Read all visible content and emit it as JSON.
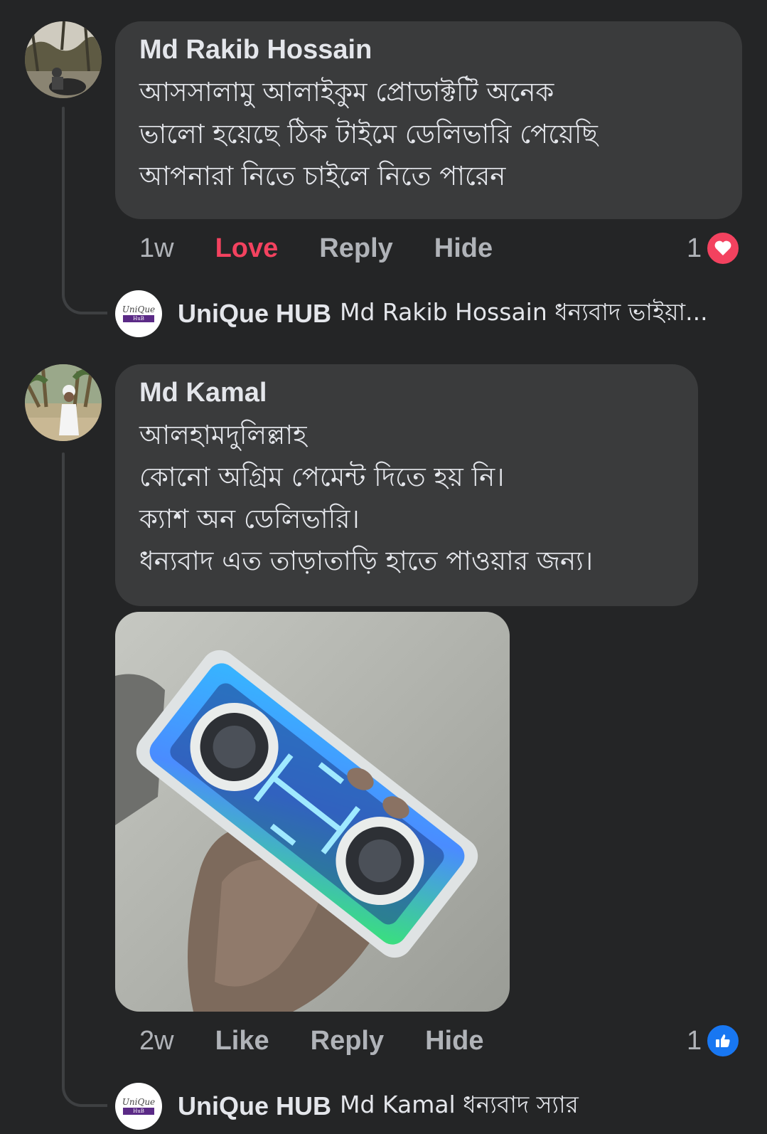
{
  "comments": [
    {
      "author": "Md Rakib Hossain",
      "lines": [
        "আসসালামু আলাইকুম প্রোডাক্টটি অনেক",
        "ভালো হয়েছে ঠিক টাইমে ডেলিভারি পেয়েছি",
        "আপনারা নিতে চাইলে নিতে পারেন"
      ],
      "time": "1w",
      "react_label": "Love",
      "reply_label": "Reply",
      "hide_label": "Hide",
      "reaction_count": "1",
      "reaction_icon": "heart-icon",
      "reaction_color": "#f3425f",
      "reply": {
        "page_name": "UniQue HUB",
        "text": "Md Rakib Hossain ধন্যবাদ ভাইয়া...",
        "logo_top": "UniQue",
        "logo_bottom": "HuB"
      }
    },
    {
      "author": "Md Kamal",
      "lines": [
        "আলহামদুলিল্লাহ",
        "কোনো অগ্রিম পেমেন্ট দিতে হয় নি।",
        "ক্যাশ অন ডেলিভারি।",
        "ধন্যবাদ এত তাড়াতাড়ি হাতে পাওয়ার জন্য।"
      ],
      "time": "2w",
      "react_label": "Like",
      "reply_label": "Reply",
      "hide_label": "Hide",
      "reaction_count": "1",
      "reaction_icon": "thumbs-up-icon",
      "reaction_color": "#1877f2",
      "reply": {
        "page_name": "UniQue HUB",
        "text": "Md Kamal ধন্যবাদ স্যার",
        "logo_top": "UniQue",
        "logo_bottom": "HuB"
      }
    }
  ],
  "colors": {
    "background": "#242526",
    "bubble": "#3a3b3c",
    "text": "#e4e6eb",
    "muted": "#b0b3b8",
    "love": "#f3425f",
    "like": "#1877f2"
  }
}
